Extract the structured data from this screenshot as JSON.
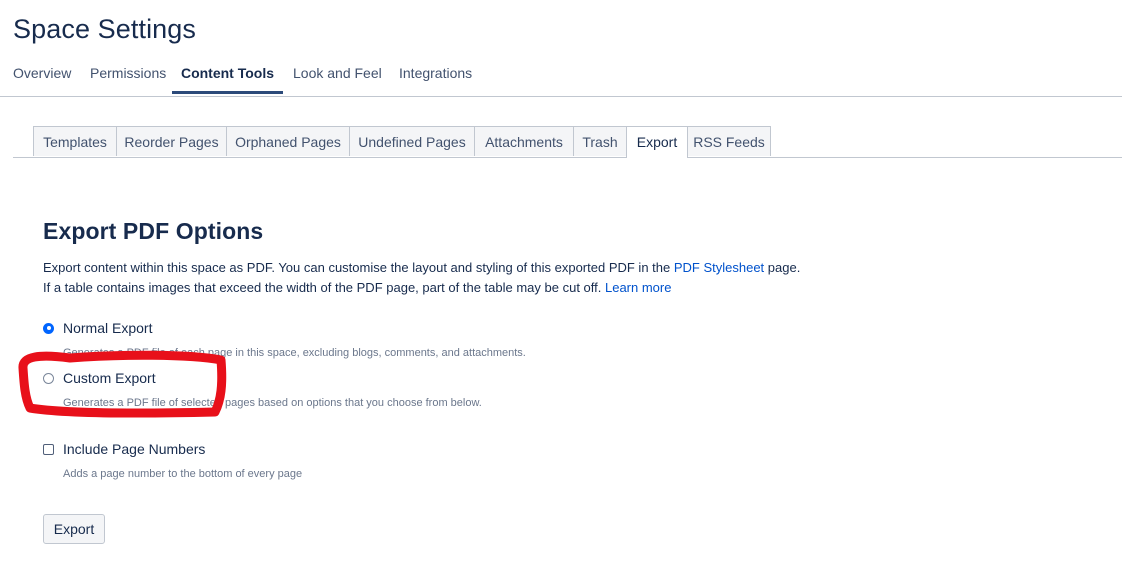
{
  "page": {
    "title": "Space Settings"
  },
  "top_nav": {
    "items": [
      {
        "label": "Overview"
      },
      {
        "label": "Permissions"
      },
      {
        "label": "Content Tools"
      },
      {
        "label": "Look and Feel"
      },
      {
        "label": "Integrations"
      }
    ],
    "active": "Content Tools"
  },
  "sub_tabs": {
    "items": [
      {
        "label": "Templates"
      },
      {
        "label": "Reorder Pages"
      },
      {
        "label": "Orphaned Pages"
      },
      {
        "label": "Undefined Pages"
      },
      {
        "label": "Attachments"
      },
      {
        "label": "Trash"
      },
      {
        "label": "Export"
      },
      {
        "label": "RSS Feeds"
      }
    ],
    "active": "Export"
  },
  "export_pdf": {
    "title": "Export PDF Options",
    "description_line1_prefix": "Export content within this space as PDF. You can customise the layout and styling of this exported PDF in the ",
    "description_line1_link": "PDF Stylesheet",
    "description_line1_suffix": " page.",
    "description_line2_prefix": "If a table contains images that exceed the width of the PDF page, part of the table may be cut off. ",
    "description_line2_link": "Learn more",
    "options": {
      "normal": {
        "label": "Normal Export",
        "help": "Generates a PDF file of each page in this space, excluding blogs, comments, and attachments.",
        "selected": true
      },
      "custom": {
        "label": "Custom Export",
        "help": "Generates a PDF file of selected pages based on options that you choose from below.",
        "selected": false
      },
      "page_numbers": {
        "label": "Include Page Numbers",
        "help": "Adds a page number to the bottom of every page",
        "checked": false
      }
    },
    "export_button_label": "Export"
  },
  "colors": {
    "accent": "#0065ff",
    "link": "#0052cc",
    "annotation": "#e8101a"
  }
}
